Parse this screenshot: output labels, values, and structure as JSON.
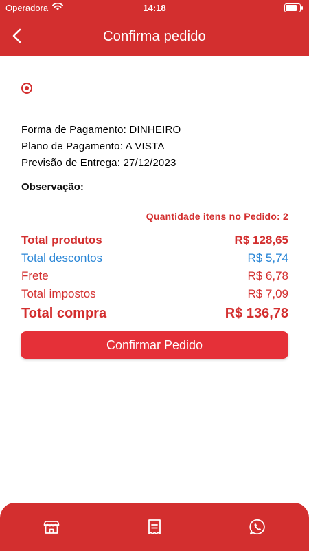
{
  "status_bar": {
    "carrier": "Operadora",
    "time": "14:18"
  },
  "header": {
    "title": "Confirma pedido"
  },
  "order_info": {
    "payment_method": "Forma de Pagamento: DINHEIRO",
    "payment_plan": "Plano de Pagamento: A VISTA",
    "delivery_forecast": "Previsão de Entrega: 27/12/2023",
    "observation_label": "Observação:",
    "items_quantity": "Quantidade itens no Pedido: 2"
  },
  "totals": {
    "products_label": "Total produtos",
    "products_value": "R$ 128,65",
    "discounts_label": "Total descontos",
    "discounts_value": "R$ 5,74",
    "freight_label": "Frete",
    "freight_value": "R$ 6,78",
    "taxes_label": "Total impostos",
    "taxes_value": "R$ 7,09",
    "purchase_label": "Total compra",
    "purchase_value": "R$ 136,78"
  },
  "actions": {
    "confirm_label": "Confirmar Pedido"
  },
  "bottom_nav": {
    "items": [
      {
        "icon": "store-icon"
      },
      {
        "icon": "receipt-icon"
      },
      {
        "icon": "whatsapp-icon"
      }
    ]
  },
  "colors": {
    "primary": "#d32f2f",
    "button": "#e53038",
    "discount": "#2a86d6"
  }
}
